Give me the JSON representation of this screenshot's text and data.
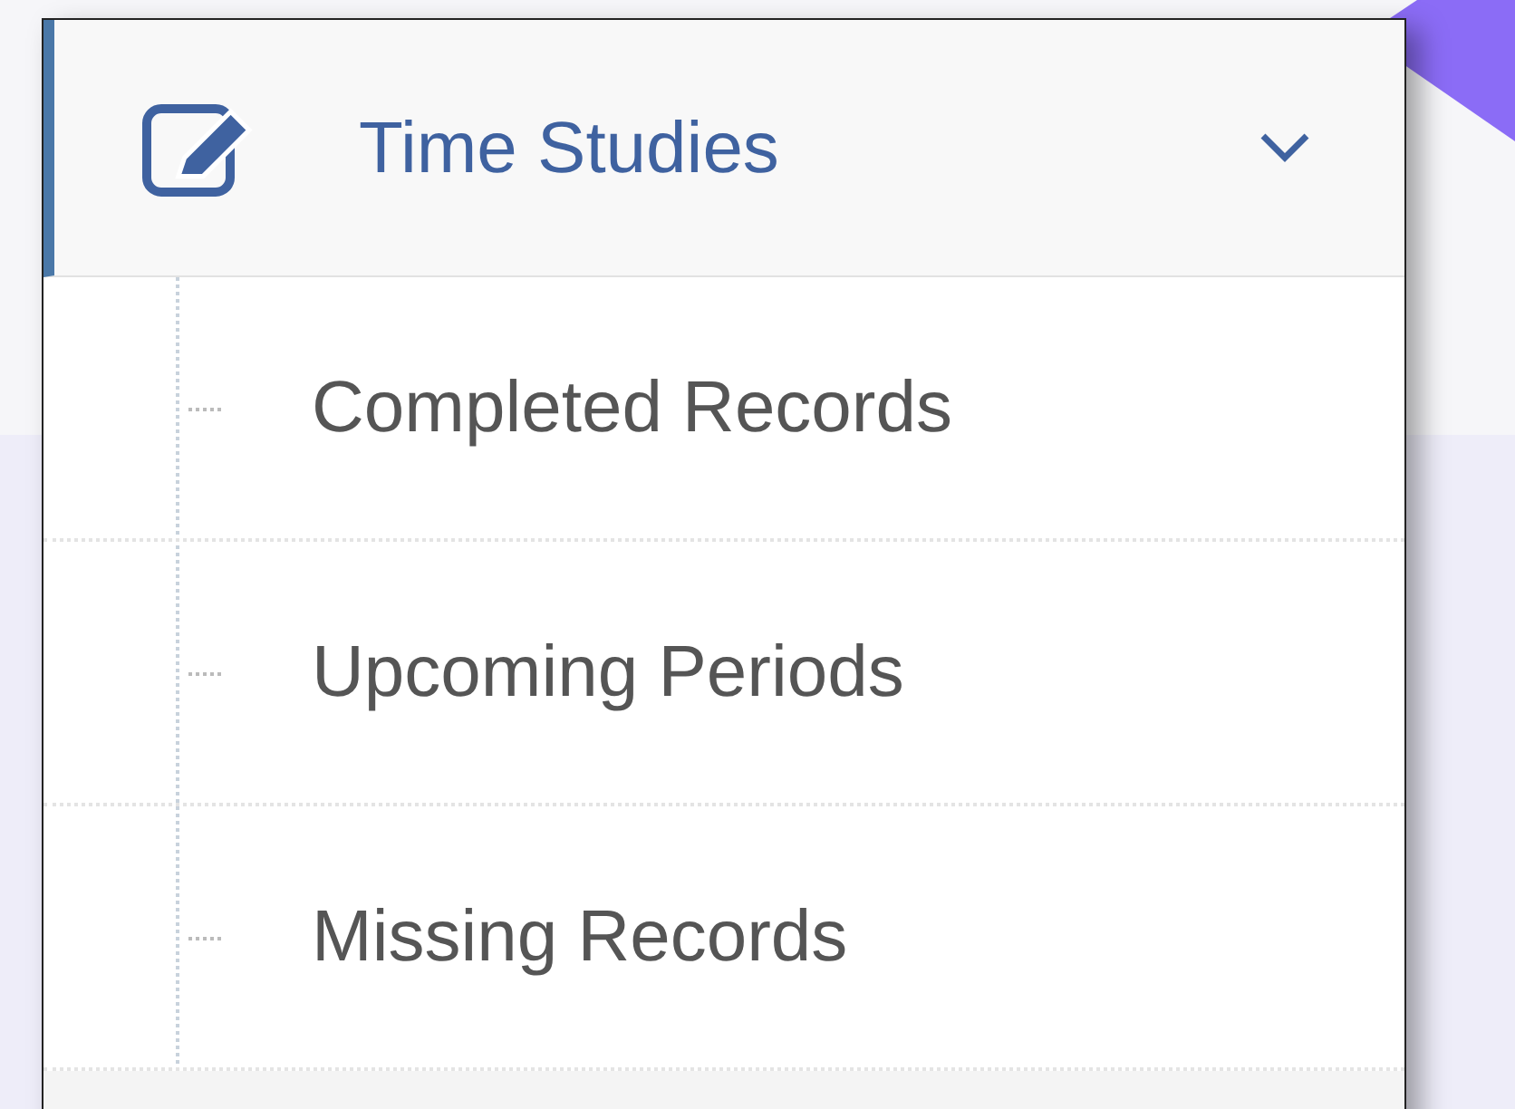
{
  "menu_section": {
    "title": "Time Studies",
    "expanded": true,
    "active": true,
    "items": [
      {
        "label": "Completed Records",
        "selected": false
      },
      {
        "label": "Upcoming Periods",
        "selected": false
      },
      {
        "label": "Missing Records",
        "selected": false
      }
    ]
  }
}
